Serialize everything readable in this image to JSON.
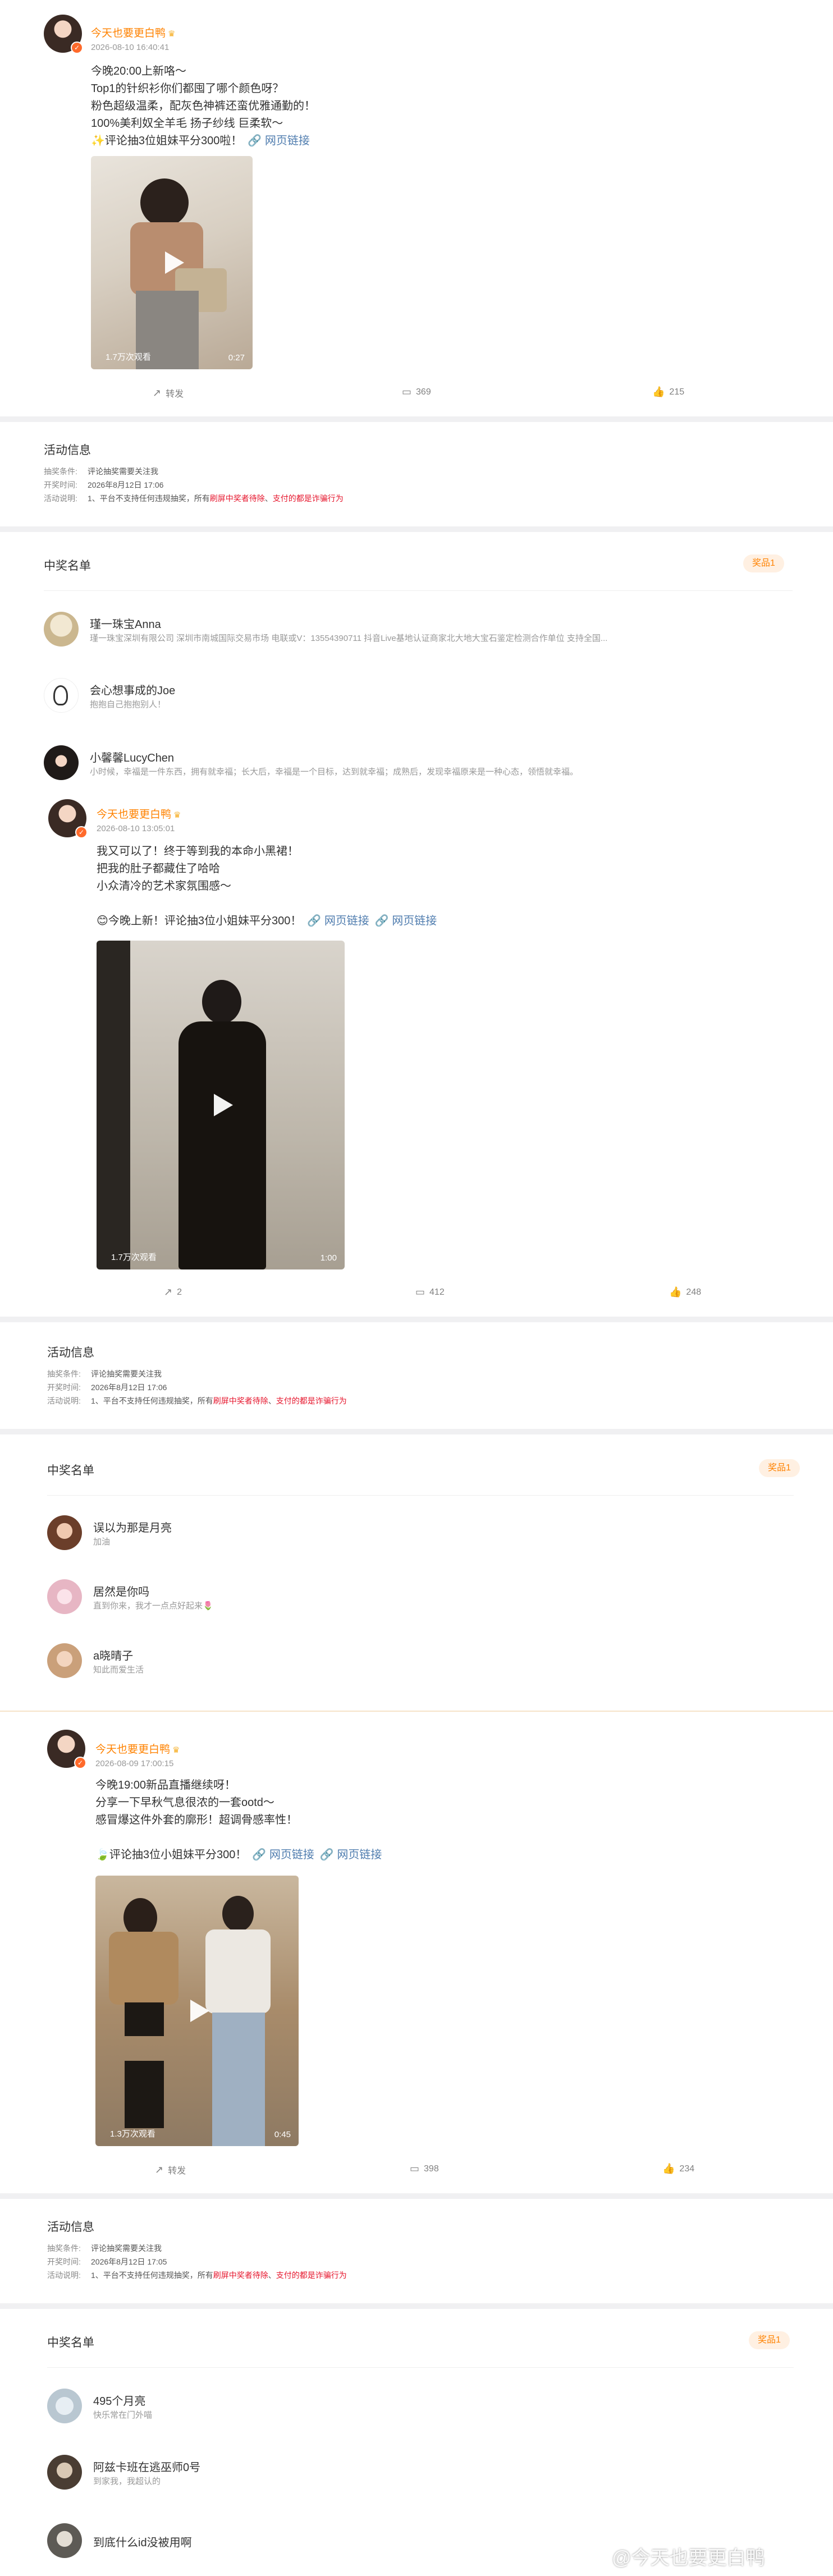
{
  "posts": [
    {
      "username": "今天也要更白鸭",
      "time": "2026-08-10 16:40:41",
      "lines": [
        "今晚20:00上新咯～",
        "Top1的针织衫你们都囤了哪个颜色呀？",
        "粉色超级温柔，配灰色神裤还蛮优雅通勤的！",
        "100%美利奴全羊毛 扬子纱线 巨柔软～",
        "✨评论抽3位姐妹平分300啦！"
      ],
      "links": [
        "网页链接"
      ],
      "video": {
        "views": "1.7万次观看",
        "duration": "0:27"
      },
      "actions": {
        "share": "转发",
        "comment": "369",
        "like": "215"
      }
    },
    {
      "username": "今天也要更白鸭",
      "time": "2026-08-10 13:05:01",
      "lines": [
        "我又可以了！终于等到我的本命小黑裙！",
        "把我的肚子都藏住了哈哈",
        "小众清冷的艺术家氛围感～",
        "",
        "😊今晚上新！评论抽3位小姐妹平分300！"
      ],
      "links": [
        "网页链接",
        "网页链接"
      ],
      "video": {
        "views": "1.7万次观看",
        "duration": "1:00"
      },
      "actions": {
        "share": "2",
        "comment": "412",
        "like": "248"
      }
    },
    {
      "username": "今天也要更白鸭",
      "time": "2026-08-09 17:00:15",
      "lines": [
        "今晚19:00新品直播继续呀！",
        "分享一下早秋气息很浓的一套ootd～",
        "感冒爆这件外套的廓形！超调骨感率性！",
        "",
        "🍃评论抽3位小姐妹平分300！"
      ],
      "links": [
        "网页链接",
        "网页链接"
      ],
      "video": {
        "views": "1.3万次观看",
        "duration": "0:45"
      },
      "actions": {
        "share": "转发",
        "comment": "398",
        "like": "234"
      }
    }
  ],
  "activities": [
    {
      "title": "活动信息",
      "rows": [
        {
          "label": "抽奖条件:",
          "value": "评论抽奖需要关注我"
        },
        {
          "label": "开奖时间:",
          "value": "2026年8月12日 17:06"
        },
        {
          "label": "活动说明:",
          "value": "1、平台不支持任何违规抽奖，所有",
          "red1": "刷屏中奖者待除",
          "mid": "、",
          "red2": "支付的都是",
          "tail": "诈骗行为"
        }
      ]
    },
    {
      "title": "活动信息",
      "rows": [
        {
          "label": "抽奖条件:",
          "value": "评论抽奖需要关注我"
        },
        {
          "label": "开奖时间:",
          "value": "2026年8月12日 17:06"
        },
        {
          "label": "活动说明:",
          "value": "1、平台不支持任何违规抽奖，所有",
          "red1": "刷屏中奖者待除",
          "mid": "、",
          "red2": "支付的都是",
          "tail": "诈骗行为"
        }
      ]
    },
    {
      "title": "活动信息",
      "rows": [
        {
          "label": "抽奖条件:",
          "value": "评论抽奖需要关注我"
        },
        {
          "label": "开奖时间:",
          "value": "2026年8月12日 17:05"
        },
        {
          "label": "活动说明:",
          "value": "1、平台不支持任何违规抽奖，所有",
          "red1": "刷屏中奖者待除",
          "mid": "、",
          "red2": "支付的都是",
          "tail": "诈骗行为"
        }
      ]
    }
  ],
  "winners": [
    {
      "title": "中奖名单",
      "prize": "奖品1",
      "items": [
        {
          "name": "瑾一珠宝Anna",
          "desc": "瑾一珠宝深圳有限公司 深圳市南城国际交易市场 电联或V：13554390711 抖音Live基地认证商家北大地大宝石鉴定检测合作单位 支持全国..."
        },
        {
          "name": "会心想事成的Joe",
          "desc": "抱抱自己抱抱别人！"
        },
        {
          "name": "小馨馨LucyChen",
          "desc": "小时候，幸福是一件东西，拥有就幸福；长大后，幸福是一个目标，达到就幸福；成熟后，发现幸福原来是一种心态，领悟就幸福。"
        }
      ]
    },
    {
      "title": "中奖名单",
      "prize": "奖品1",
      "items": [
        {
          "name": "误以为那是月亮",
          "desc": "加油"
        },
        {
          "name": "居然是你吗",
          "desc": "直到你来，我才一点点好起来🌷"
        },
        {
          "name": "a晓晴子",
          "desc": "知此而爱生活"
        }
      ]
    },
    {
      "title": "中奖名单",
      "prize": "奖品1",
      "items": [
        {
          "name": "495个月亮",
          "desc": "快乐常在门外喵"
        },
        {
          "name": "阿兹卡班在逃巫师0号",
          "desc": "到家我，我超认的"
        },
        {
          "name": "到底什么id没被用啊",
          "desc": ""
        }
      ]
    }
  ],
  "watermark": "@今天也要更白鸭",
  "colors": {
    "username": "#ff8200",
    "link": "#507daf",
    "warning": "#e6162d",
    "prize_bg": "#fff0e2",
    "band": "#f0f0f2"
  }
}
